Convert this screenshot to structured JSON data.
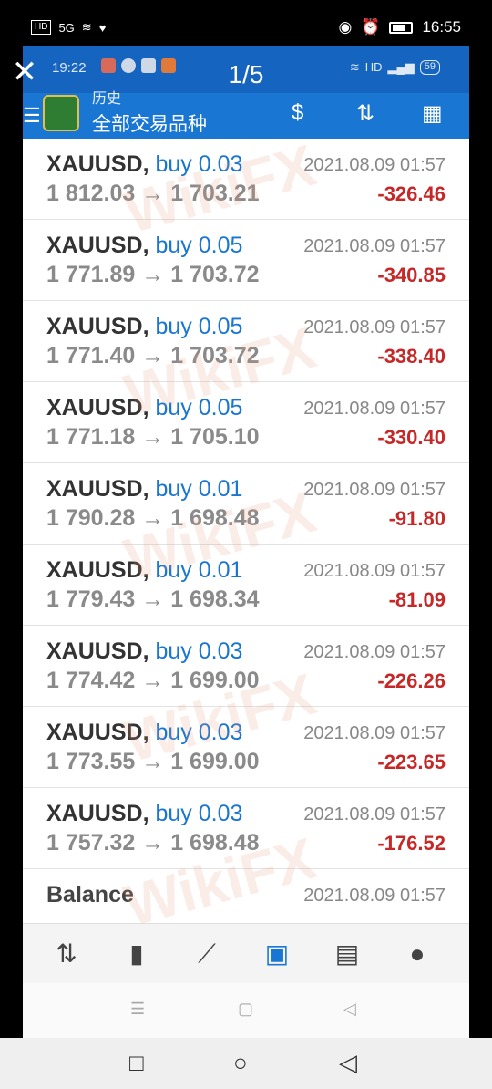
{
  "outer_status": {
    "hd": "HD",
    "signal": "5G",
    "time": "16:55"
  },
  "viewer": {
    "close_glyph": "✕",
    "counter": "1/5"
  },
  "inner_status": {
    "time": "19:22",
    "hd": "HD",
    "battery": "59"
  },
  "toolbar": {
    "subtitle": "历史",
    "title": "全部交易品种",
    "icons": [
      "menu-icon",
      "app-logo",
      "currency-filter-icon",
      "sort-icon",
      "calendar-icon"
    ]
  },
  "trades": [
    {
      "symbol": "XAUUSD,",
      "type": "buy 0.03",
      "date": "2021.08.09 01:57",
      "prices": "1 812.03 → 1 703.21",
      "profit": "-326.46"
    },
    {
      "symbol": "XAUUSD,",
      "type": "buy 0.05",
      "date": "2021.08.09 01:57",
      "prices": "1 771.89 → 1 703.72",
      "profit": "-340.85"
    },
    {
      "symbol": "XAUUSD,",
      "type": "buy 0.05",
      "date": "2021.08.09 01:57",
      "prices": "1 771.40 → 1 703.72",
      "profit": "-338.40"
    },
    {
      "symbol": "XAUUSD,",
      "type": "buy 0.05",
      "date": "2021.08.09 01:57",
      "prices": "1 771.18 → 1 705.10",
      "profit": "-330.40"
    },
    {
      "symbol": "XAUUSD,",
      "type": "buy 0.01",
      "date": "2021.08.09 01:57",
      "prices": "1 790.28 → 1 698.48",
      "profit": "-91.80"
    },
    {
      "symbol": "XAUUSD,",
      "type": "buy 0.01",
      "date": "2021.08.09 01:57",
      "prices": "1 779.43 → 1 698.34",
      "profit": "-81.09"
    },
    {
      "symbol": "XAUUSD,",
      "type": "buy 0.03",
      "date": "2021.08.09 01:57",
      "prices": "1 774.42 → 1 699.00",
      "profit": "-226.26"
    },
    {
      "symbol": "XAUUSD,",
      "type": "buy 0.03",
      "date": "2021.08.09 01:57",
      "prices": "1 773.55 → 1 699.00",
      "profit": "-223.65"
    },
    {
      "symbol": "XAUUSD,",
      "type": "buy 0.03",
      "date": "2021.08.09 01:57",
      "prices": "1 757.32 → 1 698.48",
      "profit": "-176.52"
    }
  ],
  "balance": {
    "label": "Balance",
    "date": "2021.08.09 01:57"
  },
  "bottom_nav": [
    {
      "name": "quotes-icon",
      "glyph": "⇅",
      "active": false
    },
    {
      "name": "chart-icon",
      "glyph": "▮",
      "active": false
    },
    {
      "name": "trade-icon",
      "glyph": "⟋",
      "active": false
    },
    {
      "name": "history-icon",
      "glyph": "▣",
      "active": true
    },
    {
      "name": "news-icon",
      "glyph": "▤",
      "active": false
    },
    {
      "name": "chat-icon",
      "glyph": "●",
      "active": false
    }
  ],
  "watermark": "WikiFX",
  "colors": {
    "toolbar": "#1976d2",
    "profit_negative": "#c62828",
    "type_blue": "#1976d2"
  }
}
